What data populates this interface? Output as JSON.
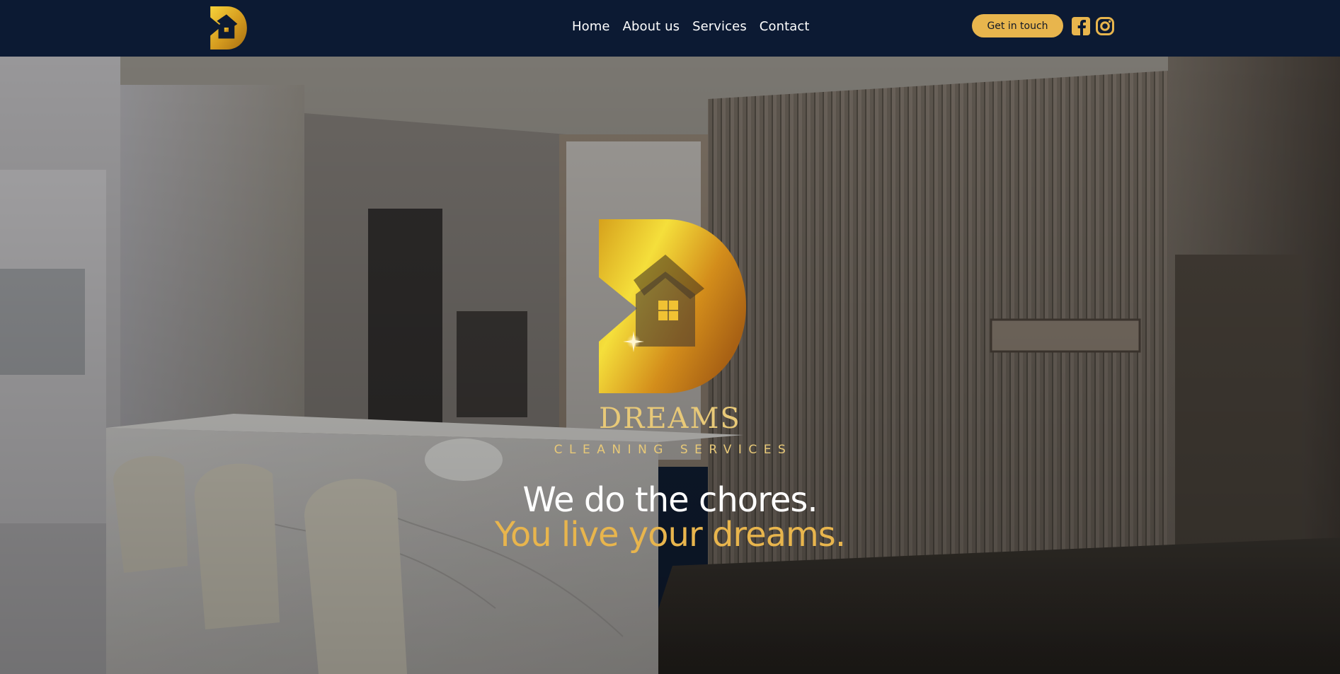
{
  "header": {
    "logo_icon": "dreams-d-house-logo-icon",
    "nav": [
      {
        "label": "Home"
      },
      {
        "label": "About us"
      },
      {
        "label": "Services"
      },
      {
        "label": "Contact"
      }
    ],
    "cta_label": "Get in touch",
    "social": [
      {
        "icon": "facebook-icon"
      },
      {
        "icon": "instagram-icon"
      }
    ]
  },
  "hero": {
    "background": "kitchen-interior-photo",
    "brand_name": "DREAMS",
    "brand_tagline": "CLEANING SERVICES",
    "headline_line1": "We do the chores.",
    "headline_line2": "You live your dreams."
  },
  "colors": {
    "header_bg": "#0c1a33",
    "accent_gold": "#e8b54d",
    "wordmark_gold": "#e8c978",
    "white": "#ffffff"
  }
}
